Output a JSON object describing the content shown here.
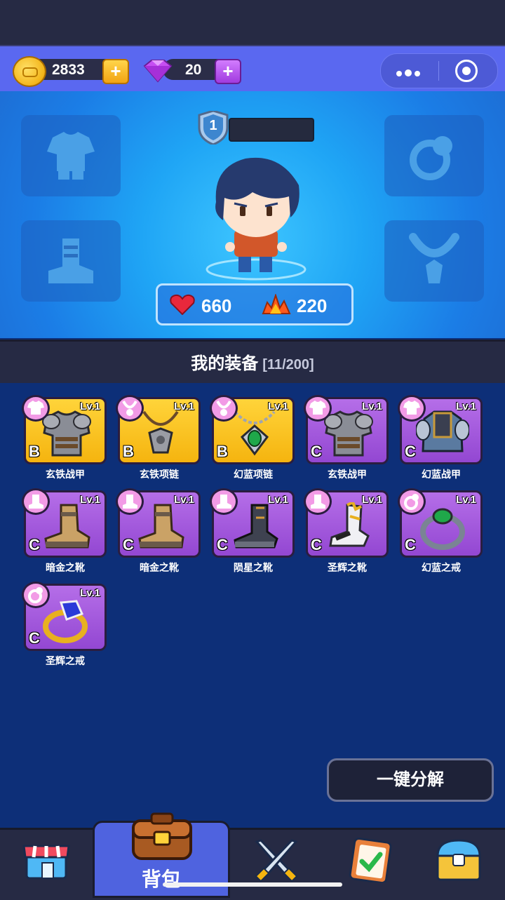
{
  "top": {
    "gold": "2833",
    "gems": "20"
  },
  "hero": {
    "level": "1",
    "hp": "660",
    "power": "220"
  },
  "equip_title": "我的装备",
  "equip_count": "[11/200]",
  "items": [
    {
      "name": "玄铁战甲",
      "level": "Lv.1",
      "grade": "B",
      "rarity": "yellow",
      "slot": "armor-icon",
      "art": "armor"
    },
    {
      "name": "玄铁项链",
      "level": "Lv.1",
      "grade": "B",
      "rarity": "yellow",
      "slot": "necklace-icon",
      "art": "necklace-iron"
    },
    {
      "name": "幻蓝项链",
      "level": "Lv.1",
      "grade": "B",
      "rarity": "yellow",
      "slot": "necklace-icon",
      "art": "necklace-green"
    },
    {
      "name": "玄铁战甲",
      "level": "Lv.1",
      "grade": "C",
      "rarity": "purple",
      "slot": "armor-icon",
      "art": "armor"
    },
    {
      "name": "幻蓝战甲",
      "level": "Lv.1",
      "grade": "C",
      "rarity": "purple",
      "slot": "armor-icon",
      "art": "armor-blue"
    },
    {
      "name": "暗金之靴",
      "level": "Lv.1",
      "grade": "C",
      "rarity": "purple",
      "slot": "boot-icon",
      "art": "boot-gold"
    },
    {
      "name": "暗金之靴",
      "level": "Lv.1",
      "grade": "C",
      "rarity": "purple",
      "slot": "boot-icon",
      "art": "boot-gold"
    },
    {
      "name": "陨星之靴",
      "level": "Lv.1",
      "grade": "C",
      "rarity": "purple",
      "slot": "boot-icon",
      "art": "boot-dark"
    },
    {
      "name": "圣辉之靴",
      "level": "Lv.1",
      "grade": "C",
      "rarity": "purple",
      "slot": "boot-icon",
      "art": "boot-holy"
    },
    {
      "name": "幻蓝之戒",
      "level": "Lv.1",
      "grade": "C",
      "rarity": "purple",
      "slot": "ring-icon",
      "art": "ring-green"
    },
    {
      "name": "圣辉之戒",
      "level": "Lv.1",
      "grade": "C",
      "rarity": "purple",
      "slot": "ring-icon",
      "art": "ring-gold"
    }
  ],
  "decompose_label": "一键分解",
  "nav": {
    "active_label": "背包"
  },
  "colors": {
    "yellow": "#f5b40f",
    "purple": "#9d52d8",
    "topbar": "#5a68f0"
  }
}
